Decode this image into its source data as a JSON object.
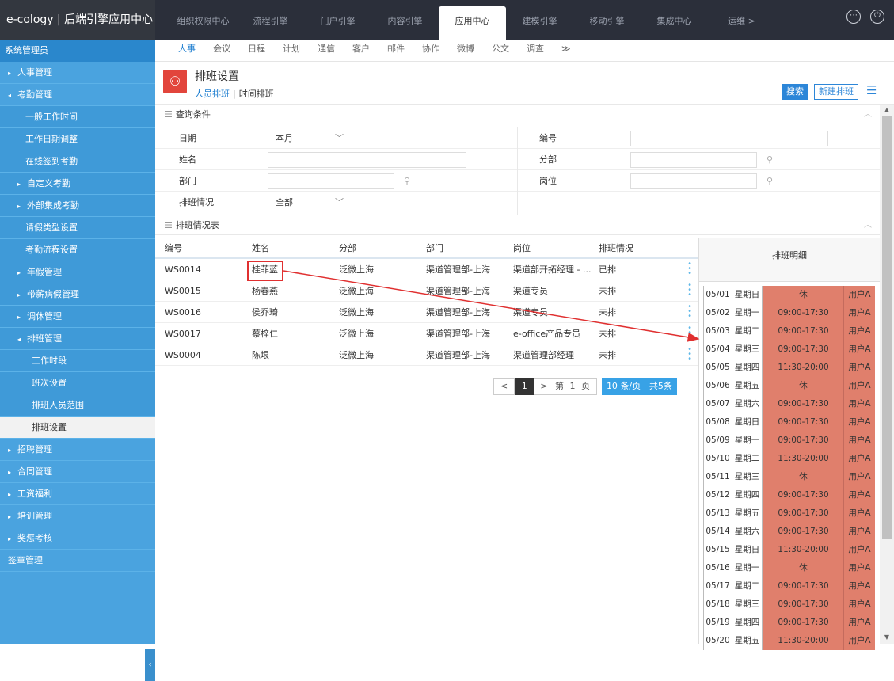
{
  "app": {
    "title": "e-cology | 后端引擎应用中心"
  },
  "topnav": [
    {
      "label": "组织权限中心",
      "active": false
    },
    {
      "label": "流程引擎",
      "active": false
    },
    {
      "label": "门户引擎",
      "active": false
    },
    {
      "label": "内容引擎",
      "active": false
    },
    {
      "label": "应用中心",
      "active": true
    },
    {
      "label": "建模引擎",
      "active": false
    },
    {
      "label": "移动引擎",
      "active": false
    },
    {
      "label": "集成中心",
      "active": false
    },
    {
      "label": "运维 >",
      "active": false
    }
  ],
  "top_icons": {
    "more": "⋯",
    "power": "⏻"
  },
  "sidebar": {
    "title": "系统管理员",
    "items": [
      {
        "label": "人事管理",
        "arrow": "▸",
        "level": "l1",
        "active": false
      },
      {
        "label": "考勤管理",
        "arrow": "◂",
        "level": "l1",
        "active": false
      },
      {
        "label": "一般工作时间",
        "arrow": "",
        "level": "l2",
        "active": false
      },
      {
        "label": "工作日期调整",
        "arrow": "",
        "level": "l2",
        "active": false
      },
      {
        "label": "在线签到考勤",
        "arrow": "",
        "level": "l2",
        "active": false
      },
      {
        "label": "自定义考勤",
        "arrow": "▸",
        "level": "l2b",
        "active": false
      },
      {
        "label": "外部集成考勤",
        "arrow": "▸",
        "level": "l2b",
        "active": false
      },
      {
        "label": "请假类型设置",
        "arrow": "",
        "level": "l2",
        "active": false
      },
      {
        "label": "考勤流程设置",
        "arrow": "",
        "level": "l2",
        "active": false
      },
      {
        "label": "年假管理",
        "arrow": "▸",
        "level": "l2b",
        "active": false
      },
      {
        "label": "带薪病假管理",
        "arrow": "▸",
        "level": "l2b",
        "active": false
      },
      {
        "label": "调休管理",
        "arrow": "▸",
        "level": "l2b",
        "active": false
      },
      {
        "label": "排班管理",
        "arrow": "◂",
        "level": "l2b",
        "active": false
      },
      {
        "label": "工作时段",
        "arrow": "",
        "level": "l3",
        "active": false
      },
      {
        "label": "班次设置",
        "arrow": "",
        "level": "l3",
        "active": false
      },
      {
        "label": "排班人员范围",
        "arrow": "",
        "level": "l3",
        "active": false
      },
      {
        "label": "排班设置",
        "arrow": "",
        "level": "l3",
        "active": true
      },
      {
        "label": "招聘管理",
        "arrow": "▸",
        "level": "l1",
        "active": false
      },
      {
        "label": "合同管理",
        "arrow": "▸",
        "level": "l1",
        "active": false
      },
      {
        "label": "工资福利",
        "arrow": "▸",
        "level": "l1",
        "active": false
      },
      {
        "label": "培训管理",
        "arrow": "▸",
        "level": "l1",
        "active": false
      },
      {
        "label": "奖惩考核",
        "arrow": "▸",
        "level": "l1",
        "active": false
      },
      {
        "label": "签章管理",
        "arrow": "",
        "level": "l1",
        "active": false
      }
    ],
    "collapse": "‹"
  },
  "subnav": [
    {
      "label": "人事",
      "active": true
    },
    {
      "label": "会议",
      "active": false
    },
    {
      "label": "日程",
      "active": false
    },
    {
      "label": "计划",
      "active": false
    },
    {
      "label": "通信",
      "active": false
    },
    {
      "label": "客户",
      "active": false
    },
    {
      "label": "邮件",
      "active": false
    },
    {
      "label": "协作",
      "active": false
    },
    {
      "label": "微博",
      "active": false
    },
    {
      "label": "公文",
      "active": false
    },
    {
      "label": "调查",
      "active": false
    },
    {
      "label": "≫",
      "active": false
    }
  ],
  "header": {
    "title": "排班设置",
    "tabs": [
      "人员排班",
      "时间排班"
    ],
    "tab_sep": "|",
    "search_btn": "搜索",
    "new_btn": "新建排班"
  },
  "query": {
    "title": "查询条件",
    "date_label": "日期",
    "date_value": "本月",
    "number_label": "编号",
    "name_label": "姓名",
    "branch_label": "分部",
    "dept_label": "部门",
    "post_label": "岗位",
    "status_label": "排班情况",
    "status_value": "全部"
  },
  "table": {
    "title": "排班情况表",
    "columns": [
      "编号",
      "姓名",
      "分部",
      "部门",
      "岗位",
      "排班情况"
    ],
    "rows": [
      [
        "WS0014",
        "桂菲蓝",
        "泛微上海",
        "渠道管理部-上海",
        "渠道部开拓经理 - ...",
        "已排"
      ],
      [
        "WS0015",
        "杨春燕",
        "泛微上海",
        "渠道管理部-上海",
        "渠道专员",
        "未排"
      ],
      [
        "WS0016",
        "侯乔琦",
        "泛微上海",
        "渠道管理部-上海",
        "渠道专员",
        "未排"
      ],
      [
        "WS0017",
        "蔡梓仁",
        "泛微上海",
        "渠道管理部-上海",
        "e-office产品专员",
        "未排"
      ],
      [
        "WS0004",
        "陈垠",
        "泛微上海",
        "渠道管理部-上海",
        "渠道管理部经理",
        "未排"
      ]
    ]
  },
  "pager": {
    "prev": "<",
    "current": "1",
    "next": ">",
    "page_prefix": "第",
    "page_value": "1",
    "page_suffix": "页",
    "per_page": "10",
    "info": "条/页 | 共5条"
  },
  "detail": {
    "title": "排班明细",
    "rows": [
      [
        "05/01",
        "星期日",
        "休",
        "用户A"
      ],
      [
        "05/02",
        "星期一",
        "09:00-17:30",
        "用户A"
      ],
      [
        "05/03",
        "星期二",
        "09:00-17:30",
        "用户A"
      ],
      [
        "05/04",
        "星期三",
        "09:00-17:30",
        "用户A"
      ],
      [
        "05/05",
        "星期四",
        "11:30-20:00",
        "用户A"
      ],
      [
        "05/06",
        "星期五",
        "休",
        "用户A"
      ],
      [
        "05/07",
        "星期六",
        "09:00-17:30",
        "用户A"
      ],
      [
        "05/08",
        "星期日",
        "09:00-17:30",
        "用户A"
      ],
      [
        "05/09",
        "星期一",
        "09:00-17:30",
        "用户A"
      ],
      [
        "05/10",
        "星期二",
        "11:30-20:00",
        "用户A"
      ],
      [
        "05/11",
        "星期三",
        "休",
        "用户A"
      ],
      [
        "05/12",
        "星期四",
        "09:00-17:30",
        "用户A"
      ],
      [
        "05/13",
        "星期五",
        "09:00-17:30",
        "用户A"
      ],
      [
        "05/14",
        "星期六",
        "09:00-17:30",
        "用户A"
      ],
      [
        "05/15",
        "星期日",
        "11:30-20:00",
        "用户A"
      ],
      [
        "05/16",
        "星期一",
        "休",
        "用户A"
      ],
      [
        "05/17",
        "星期二",
        "09:00-17:30",
        "用户A"
      ],
      [
        "05/18",
        "星期三",
        "09:00-17:30",
        "用户A"
      ],
      [
        "05/19",
        "星期四",
        "09:00-17:30",
        "用户A"
      ],
      [
        "05/20",
        "星期五",
        "11:30-20:00",
        "用户A"
      ]
    ]
  },
  "colors": {
    "accent": "#2c86d8",
    "sidebar": "#4aa3df",
    "shift": "#e07f6c",
    "annotation": "#e03030"
  }
}
